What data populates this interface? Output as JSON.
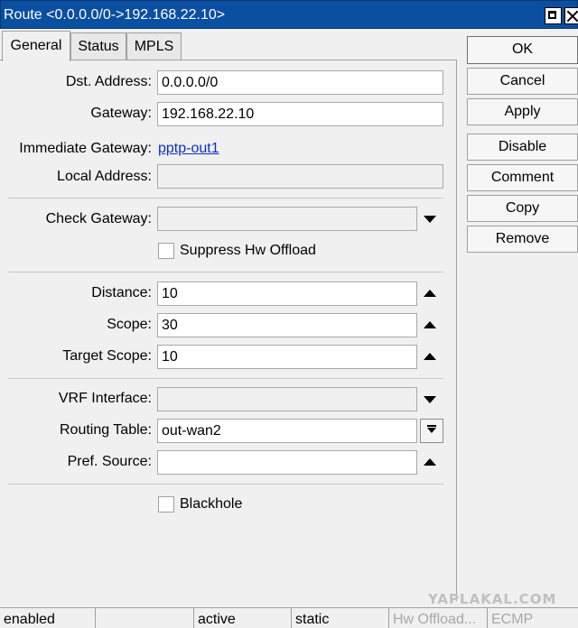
{
  "window": {
    "title": "Route <0.0.0.0/0->192.168.22.10>"
  },
  "tabs": [
    {
      "label": "General",
      "active": true
    },
    {
      "label": "Status",
      "active": false
    },
    {
      "label": "MPLS",
      "active": false
    }
  ],
  "form": {
    "dst_address": {
      "label": "Dst. Address:",
      "value": "0.0.0.0/0"
    },
    "gateway": {
      "label": "Gateway:",
      "value": "192.168.22.10"
    },
    "immediate_gateway": {
      "label": "Immediate Gateway:",
      "value": "pptp-out1"
    },
    "local_address": {
      "label": "Local Address:",
      "value": ""
    },
    "check_gateway": {
      "label": "Check Gateway:",
      "value": ""
    },
    "suppress_hw_offload": {
      "label": "Suppress Hw Offload",
      "checked": false
    },
    "distance": {
      "label": "Distance:",
      "value": "10"
    },
    "scope": {
      "label": "Scope:",
      "value": "30"
    },
    "target_scope": {
      "label": "Target Scope:",
      "value": "10"
    },
    "vrf_interface": {
      "label": "VRF Interface:",
      "value": ""
    },
    "routing_table": {
      "label": "Routing Table:",
      "value": "out-wan2"
    },
    "pref_source": {
      "label": "Pref. Source:",
      "value": ""
    },
    "blackhole": {
      "label": "Blackhole",
      "checked": false
    }
  },
  "buttons": {
    "ok": "OK",
    "cancel": "Cancel",
    "apply": "Apply",
    "disable": "Disable",
    "comment": "Comment",
    "copy": "Copy",
    "remove": "Remove"
  },
  "status_bar": {
    "state": "enabled",
    "blank": "",
    "active": "active",
    "type": "static",
    "hw_offload": "Hw Offload...",
    "ecmp": "ECMP"
  },
  "watermark": "YAPLAKAL.COM",
  "colors": {
    "titlebar": "#0a4fa0",
    "link": "#0a2fc8",
    "window_bg": "#f0f0f0"
  },
  "icons": {
    "window_maximize": "maximize-icon",
    "window_close": "close-icon",
    "dropdown": "triangle-down-icon",
    "spin": "triangle-up-icon",
    "combo": "combo-down-icon"
  }
}
